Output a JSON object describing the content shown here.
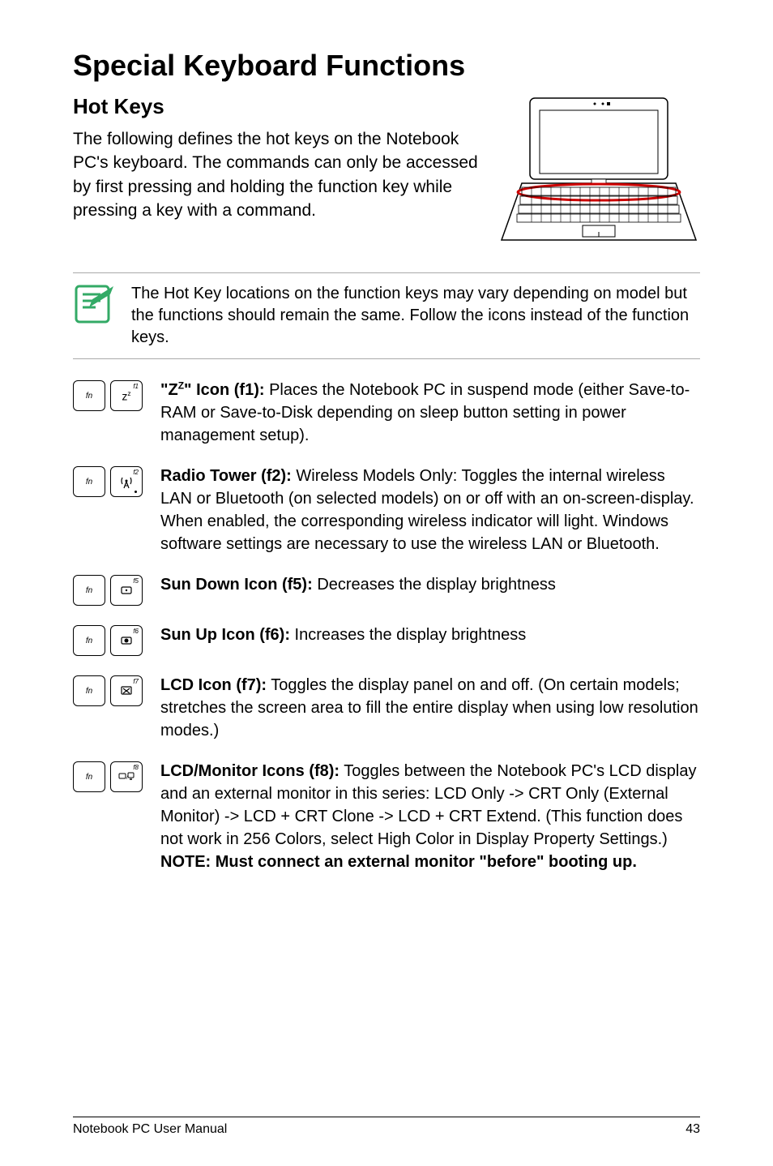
{
  "heading": "Special Keyboard Functions",
  "subheading": "Hot Keys",
  "intro": "The following defines the hot keys on the Notebook PC's keyboard. The commands can only be accessed by first pressing and holding the function key while pressing a key with a command.",
  "note": "The Hot Key locations on the function keys may vary depending on model but the functions should remain the same. Follow the icons instead of the function keys.",
  "items": {
    "zz": {
      "title": "\"ZZ\" Icon (f1):",
      "desc": " Places the Notebook PC in suspend mode (either Save-to-RAM or Save-to-Disk depending on sleep button setting in power management setup)."
    },
    "radio": {
      "title": "Radio Tower (f2):",
      "desc": " Wireless Models Only: Toggles the internal wireless LAN or Bluetooth (on selected models) on or off with an on-screen-display. When enabled, the corresponding wireless indicator will light. Windows software settings are necessary to use the wireless LAN or Bluetooth."
    },
    "sundown": {
      "title": "Sun Down Icon (f5):",
      "desc": " Decreases the display brightness"
    },
    "sunup": {
      "title": "Sun Up Icon (f6):",
      "desc": " Increases the display brightness"
    },
    "lcd": {
      "title": "LCD Icon (f7):",
      "desc": " Toggles the display panel on and off. (On certain models; stretches the screen area to fill the entire display when using low resolution modes.)"
    },
    "lcdmon": {
      "title": "LCD/Monitor Icons (f8):",
      "desc_a": " Toggles between the Notebook PC's LCD display and an external monitor in this series: LCD Only -> CRT Only (External Monitor) -> LCD + CRT Clone -> LCD + CRT Extend. (This function does not work in 256 Colors, select High Color in Display Property Settings.) ",
      "note_bold": "NOTE: Must connect an external monitor \"before\" booting up."
    }
  },
  "footer_left": "Notebook PC User Manual",
  "footer_right": "43",
  "fn_label": "fn",
  "f_labels": {
    "f1": "f1",
    "f2": "f2",
    "f5": "f5",
    "f6": "f6",
    "f7": "f7",
    "f8": "f8"
  }
}
